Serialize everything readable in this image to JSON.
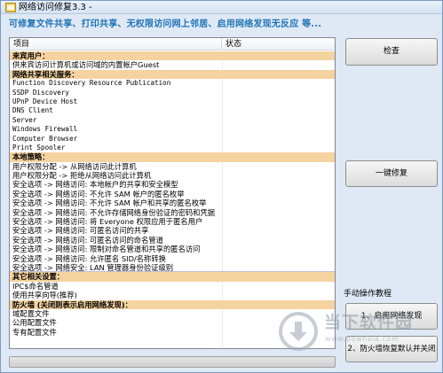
{
  "window": {
    "title": "网络访问修复3.3 -",
    "banner": "可修复文件共享、打印共享、无权限访问网上邻居、启用网络发现无反应  等..."
  },
  "list": {
    "columns": {
      "item": "项目",
      "status": "状态"
    },
    "rows": [
      {
        "text": "来宾用户：",
        "kind": "section"
      },
      {
        "text": "供来宾访问计算机或访问域的内置帐户Guest",
        "kind": "normal"
      },
      {
        "text": "网络共享相关服务：",
        "kind": "section"
      },
      {
        "text": "Function Discovery Resource Publication",
        "kind": "mono"
      },
      {
        "text": "SSDP Discovery",
        "kind": "mono"
      },
      {
        "text": "UPnP Device Host",
        "kind": "mono"
      },
      {
        "text": "DNS Client",
        "kind": "mono"
      },
      {
        "text": "Server",
        "kind": "mono"
      },
      {
        "text": "Windows Firewall",
        "kind": "mono"
      },
      {
        "text": "Computer Browser",
        "kind": "mono"
      },
      {
        "text": "Print Spooler",
        "kind": "mono"
      },
      {
        "text": "本地策略：",
        "kind": "section"
      },
      {
        "text": "用户权限分配 -> 从网络访问此计算机",
        "kind": "normal"
      },
      {
        "text": "用户权限分配 -> 拒绝从网络访问此计算机",
        "kind": "normal"
      },
      {
        "text": "安全选项 -> 网络访问: 本地帐户的共享和安全模型",
        "kind": "normal"
      },
      {
        "text": "安全选项 -> 网络访问: 不允许 SAM 帐户的匿名枚举",
        "kind": "normal"
      },
      {
        "text": "安全选项 -> 网络访问: 不允许 SAM 帐户和共享的匿名枚举",
        "kind": "normal"
      },
      {
        "text": "安全选项 -> 网络访问: 不允许存储网络身份验证的密码和凭据",
        "kind": "normal"
      },
      {
        "text": "安全选项 -> 网络访问: 将 Everyone 权限应用于匿名用户",
        "kind": "normal"
      },
      {
        "text": "安全选项 -> 网络访问: 可匿名访问的共享",
        "kind": "normal"
      },
      {
        "text": "安全选项 -> 网络访问: 可匿名访问的命名管道",
        "kind": "normal"
      },
      {
        "text": "安全选项 -> 网络访问: 限制对命名管道和共享的匿名访问",
        "kind": "normal"
      },
      {
        "text": "安全选项 -> 网络访问: 允许匿名 SID/名称转换",
        "kind": "normal"
      },
      {
        "text": "安全选项 -> 网络安全: LAN 管理器身份验证级别",
        "kind": "normal",
        "sep": true
      },
      {
        "text": "其它相关设置：",
        "kind": "section"
      },
      {
        "text": "IPC$命名管道",
        "kind": "normal"
      },
      {
        "text": "使用共享向导(推荐)",
        "kind": "normal"
      },
      {
        "text": "防火墙 (关闭则表示启用网络发现)：",
        "kind": "section"
      },
      {
        "text": "域配置文件",
        "kind": "normal"
      },
      {
        "text": "公用配置文件",
        "kind": "normal"
      },
      {
        "text": "专有配置文件",
        "kind": "normal"
      }
    ]
  },
  "buttons": {
    "check": "检查",
    "repair": "一键修复",
    "enable_discovery": "1、启用网络发现",
    "firewall": "2、防火墙恢复默认并关闭"
  },
  "manual": {
    "label": "手动操作教程"
  },
  "progress": {
    "value": 0.0
  },
  "watermark": {
    "name": "当下软件园",
    "url": "www.downxia.com"
  },
  "icons": {
    "app": "app-window-icon",
    "watermark": "downxia-logo-icon"
  },
  "colors": {
    "section_bg": "#f5d3a1",
    "banner_text": "#1f73b7",
    "window_bg": "#dfe9f5",
    "progress_fill": "#3ec43e"
  }
}
